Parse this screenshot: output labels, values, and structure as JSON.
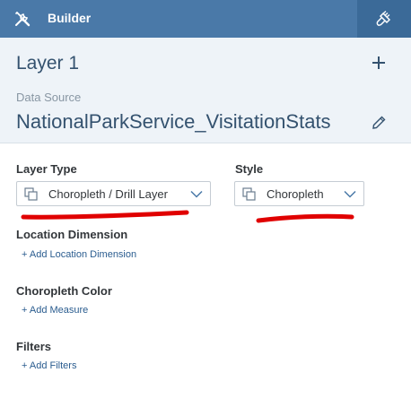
{
  "header": {
    "title": "Builder",
    "left_icon": "tools-icon",
    "right_icon": "paintbrush-icon",
    "colors": {
      "bar": "#4a79a8",
      "active_tab": "#3b6a98"
    }
  },
  "layer": {
    "title": "Layer 1",
    "add_icon": "plus-icon",
    "data_source_label": "Data Source",
    "data_source_value": "NationalParkService_VisitationStats",
    "edit_icon": "pencil-icon"
  },
  "layer_type": {
    "label": "Layer Type",
    "selected": "Choropleth / Drill Layer"
  },
  "style": {
    "label": "Style",
    "selected": "Choropleth"
  },
  "location_dimension": {
    "label": "Location Dimension",
    "add_link": "+ Add Location Dimension"
  },
  "choropleth_color": {
    "label": "Choropleth Color",
    "add_link": "+ Add Measure"
  },
  "filters": {
    "label": "Filters",
    "add_link": "+ Add Filters"
  },
  "annotation_color": "#e00000"
}
